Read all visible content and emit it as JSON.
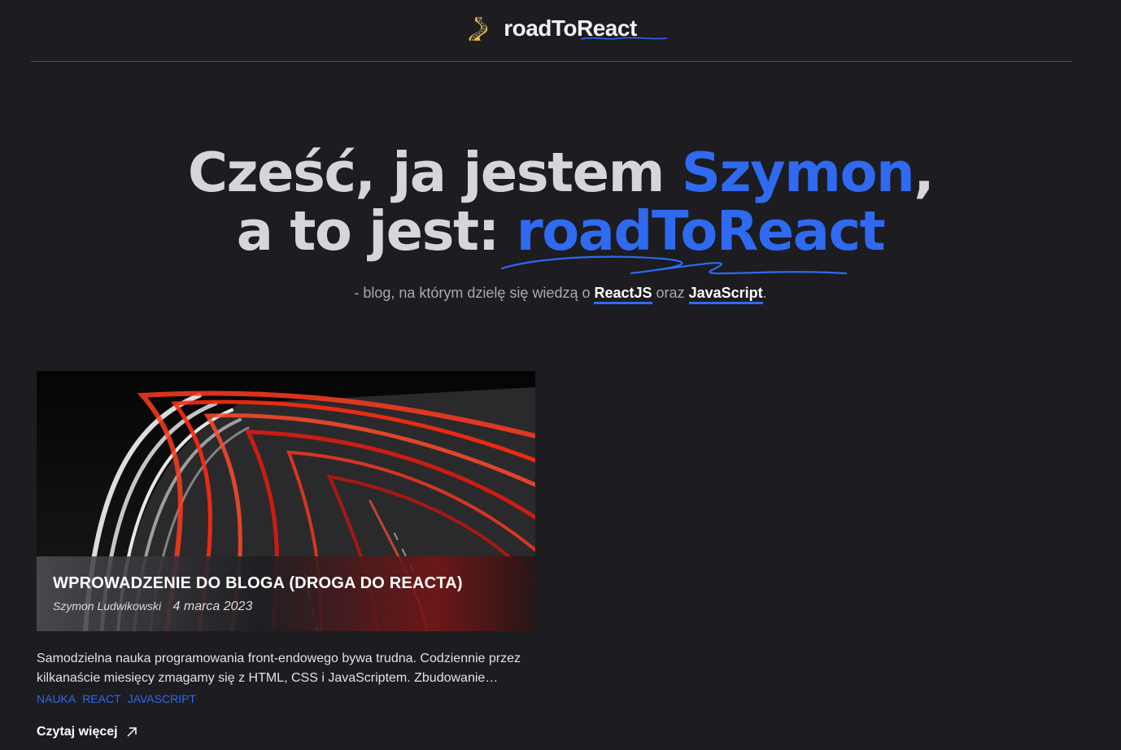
{
  "header": {
    "logo_text": "roadToReact",
    "logo_icon": "road-icon"
  },
  "hero": {
    "line1_prefix": "Cześć, ja jestem ",
    "line1_name": "Szymon",
    "line1_suffix": ",",
    "line2_prefix": "a to jest: ",
    "line2_brand": "roadToReact",
    "tagline_prefix": "- blog, na którym dzielę się wiedzą o ",
    "tagline_link1": "ReactJS",
    "tagline_middle": " oraz ",
    "tagline_link2": "JavaScript",
    "tagline_suffix": "."
  },
  "post": {
    "title": "WPROWADZENIE DO BLOGA (DROGA DO REACTA)",
    "author": "Szymon Ludwikowski",
    "date": "4 marca 2023",
    "excerpt": "Samodzielna nauka programowania front-endowego bywa trudna. Codziennie przez kilkanaście miesięcy zmagamy się z HTML, CSS i JavaScriptem. Zbudowanie…",
    "tags": [
      "NAUKA",
      "REACT",
      "JAVASCRIPT"
    ],
    "read_more": "Czytaj więcej",
    "image_alt": "light-trails-highway-image"
  },
  "colors": {
    "background": "#1c1c21",
    "accent": "#2f6af0",
    "heading": "#d5d5da",
    "text": "#e2e2e6"
  }
}
